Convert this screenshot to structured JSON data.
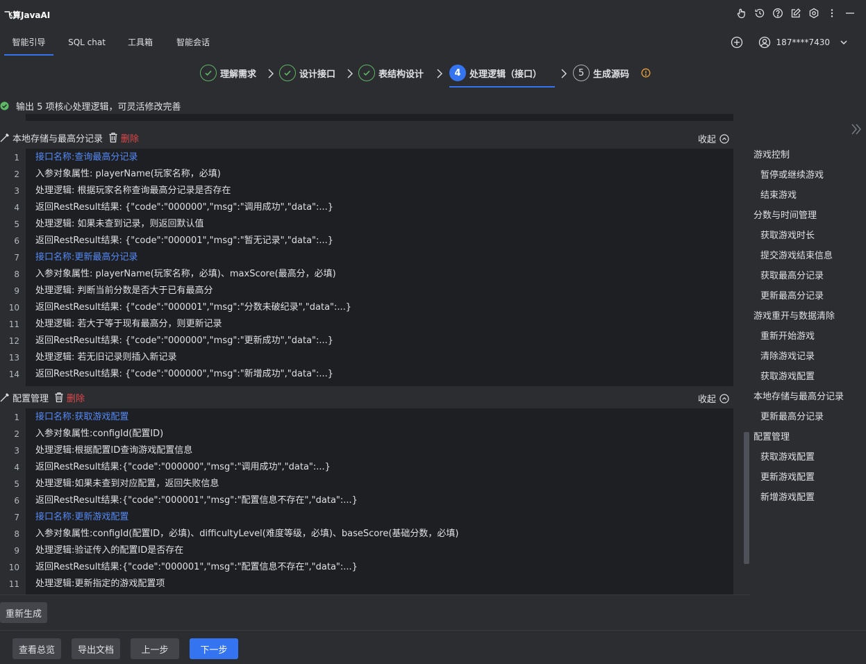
{
  "app": {
    "title": "飞算JavaAI"
  },
  "tabs": [
    {
      "label": "智能引导",
      "active": true
    },
    {
      "label": "SQL chat"
    },
    {
      "label": "工具箱"
    },
    {
      "label": "智能会话"
    }
  ],
  "user": {
    "account": "187****7430"
  },
  "steps": [
    {
      "number": "✓",
      "label": "理解需求",
      "state": "done"
    },
    {
      "number": "✓",
      "label": "设计接口",
      "state": "done"
    },
    {
      "number": "✓",
      "label": "表结构设计",
      "state": "done"
    },
    {
      "number": "4",
      "label": "处理逻辑（接口）",
      "state": "current"
    },
    {
      "number": "5",
      "label": "生成源码",
      "state": "todo"
    }
  ],
  "status": {
    "text": "输出 5 项核心处理逻辑，可灵活修改完善"
  },
  "sections": [
    {
      "title": "本地存储与最高分记录",
      "delete_label": "删除",
      "collapse_label": "收起",
      "lines": [
        {
          "no": "1",
          "text": "接口名称:查询最高分记录",
          "link": true
        },
        {
          "no": "2",
          "text": "入参对象属性: playerName(玩家名称，必填)"
        },
        {
          "no": "3",
          "text": "处理逻辑: 根据玩家名称查询最高分记录是否存在"
        },
        {
          "no": "4",
          "text": "返回RestResult结果: {\"code\":\"000000\",\"msg\":\"调用成功\",\"data\":...}"
        },
        {
          "no": "5",
          "text": "处理逻辑: 如果未查到记录，则返回默认值"
        },
        {
          "no": "6",
          "text": "返回RestResult结果: {\"code\":\"000001\",\"msg\":\"暂无记录\",\"data\":...}"
        },
        {
          "no": "7",
          "text": "接口名称:更新最高分记录",
          "link": true
        },
        {
          "no": "8",
          "text": "入参对象属性: playerName(玩家名称，必填)、maxScore(最高分，必填)"
        },
        {
          "no": "9",
          "text": "处理逻辑: 判断当前分数是否大于已有最高分"
        },
        {
          "no": "10",
          "text": "返回RestResult结果: {\"code\":\"000001\",\"msg\":\"分数未破纪录\",\"data\":...}"
        },
        {
          "no": "11",
          "text": "处理逻辑: 若大于等于现有最高分，则更新记录"
        },
        {
          "no": "12",
          "text": "返回RestResult结果: {\"code\":\"000000\",\"msg\":\"更新成功\",\"data\":...}"
        },
        {
          "no": "13",
          "text": "处理逻辑: 若无旧记录则插入新记录"
        },
        {
          "no": "14",
          "text": "返回RestResult结果: {\"code\":\"000000\",\"msg\":\"新增成功\",\"data\":...}"
        }
      ]
    },
    {
      "title": "配置管理",
      "delete_label": "删除",
      "collapse_label": "收起",
      "lines": [
        {
          "no": "1",
          "text": "接口名称:获取游戏配置",
          "link": true
        },
        {
          "no": "2",
          "text": "入参对象属性:configId(配置ID)"
        },
        {
          "no": "3",
          "text": "处理逻辑:根据配置ID查询游戏配置信息"
        },
        {
          "no": "4",
          "text": "返回RestResult结果:{\"code\":\"000000\",\"msg\":\"调用成功\",\"data\":...}"
        },
        {
          "no": "5",
          "text": "处理逻辑:如果未查到对应配置，返回失败信息"
        },
        {
          "no": "6",
          "text": "返回RestResult结果:{\"code\":\"000001\",\"msg\":\"配置信息不存在\",\"data\":...}"
        },
        {
          "no": "7",
          "text": "接口名称:更新游戏配置",
          "link": true
        },
        {
          "no": "8",
          "text": "入参对象属性:configId(配置ID，必填)、difficultyLevel(难度等级，必填)、baseScore(基础分数，必填)"
        },
        {
          "no": "9",
          "text": "处理逻辑:验证传入的配置ID是否存在"
        },
        {
          "no": "10",
          "text": "返回RestResult结果:{\"code\":\"000001\",\"msg\":\"配置信息不存在\",\"data\":...}"
        },
        {
          "no": "11",
          "text": "处理逻辑:更新指定的游戏配置项"
        }
      ]
    }
  ],
  "outline": [
    {
      "label": "游戏控制",
      "level": 0
    },
    {
      "label": "暂停或继续游戏",
      "level": 1
    },
    {
      "label": "结束游戏",
      "level": 1
    },
    {
      "label": "分数与时间管理",
      "level": 0
    },
    {
      "label": "获取游戏时长",
      "level": 1
    },
    {
      "label": "提交游戏结束信息",
      "level": 1
    },
    {
      "label": "获取最高分记录",
      "level": 1
    },
    {
      "label": "更新最高分记录",
      "level": 1
    },
    {
      "label": "游戏重开与数据清除",
      "level": 0
    },
    {
      "label": "重新开始游戏",
      "level": 1
    },
    {
      "label": "清除游戏记录",
      "level": 1
    },
    {
      "label": "获取游戏配置",
      "level": 1
    },
    {
      "label": "本地存储与最高分记录",
      "level": 0
    },
    {
      "label": "更新最高分记录",
      "level": 1
    },
    {
      "label": "配置管理",
      "level": 0
    },
    {
      "label": "获取游戏配置",
      "level": 1
    },
    {
      "label": "更新游戏配置",
      "level": 1
    },
    {
      "label": "新增游戏配置",
      "level": 1
    }
  ],
  "actions": {
    "regenerate": "重新生成",
    "overview": "查看总览",
    "export": "导出文档",
    "prev": "上一步",
    "next": "下一步"
  },
  "colors": {
    "accent": "#3574f0",
    "success": "#5fb865",
    "danger": "#e0484b",
    "link": "#548af7",
    "warning": "#e6a23c"
  }
}
